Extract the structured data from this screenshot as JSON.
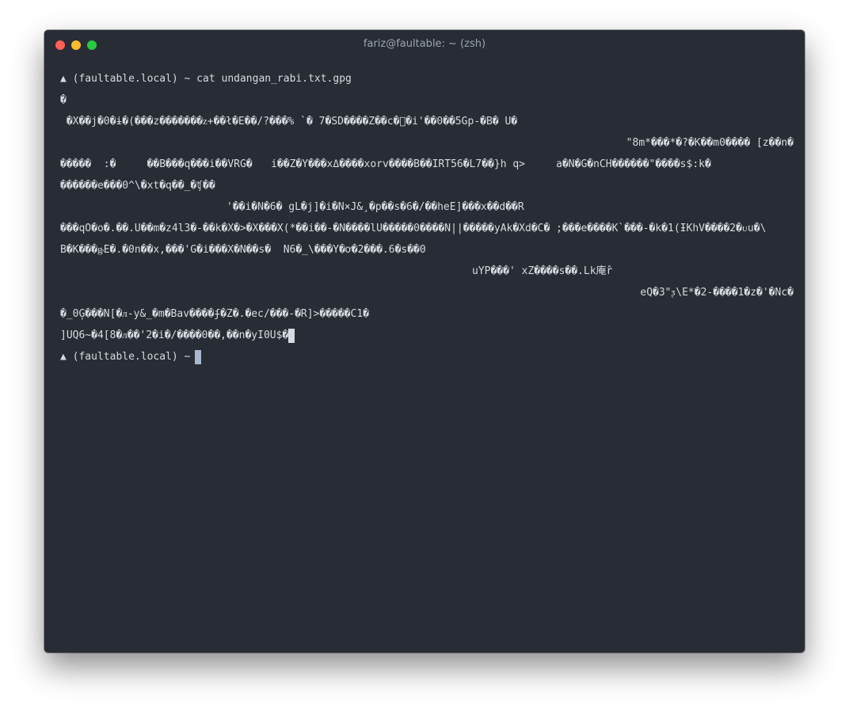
{
  "window": {
    "title": "fariz@faultable: ~ (zsh)"
  },
  "terminal": {
    "prompt": "▲ (faultable.local) ~ cat undangan_rabi.txt.gpg",
    "output": [
      "�",
      " �X��j�0�ɨ�(���z�������ᴢ+��ł�E��/?���% `� 7�SD����Z��c�\u0000�i'��0��5Gp-�B� U�",
      "\"8m*���*�?�K��m0���� [z��n�",
      "�����  :�     ��B���q���i��VRG�   i��Z�Y���xΔ����xorv����B��IRT56�L7��}h q>     a�N�G�nCH������\"����s$:k�",
      "������e���0^\\�xt�q��_�ʧ��",
      "'��i�N�6� gL�j]�i�N×J&¸�p��s�6�/��heE]���x��d��R",
      "���qO�o�.��.U��m�z4l3�-��k�X�>�X���X(*��i��-�N����lU�����0����N||�����yAk�Xd�C� ;���e����K`���-�k�1(ƗKhV����2�ᴜu�\\",
      "B�K���ᶃE�.�0n��x,���'G�i���X�N��s�  N6�_\\���Y�ơ�2���.6�s��0",
      "uYP���' xZ����s��.Lk庵r̂",
      "eQ�3\"ᶚ\\E*�2-����1�z�'�Nc�",
      "�_0Ģ���N[�ᴫ-y&_�m�Bav����ʄ�Z�.�ec/���-�R]>�����C1�",
      "]UQ6~�4[8�ᴫ��'2�i�/����0��,��n�yI0U$�"
    ],
    "last_glyph": "%",
    "prompt2": "▲ (faultable.local) ~"
  }
}
